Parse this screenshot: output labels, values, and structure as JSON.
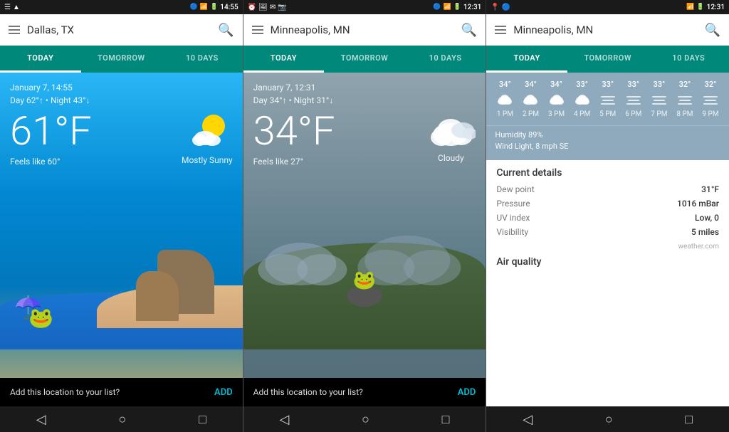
{
  "status_bars": [
    {
      "left_icons": "≡ ▲",
      "time": "14:55",
      "right_icons": "🔵 📶 🔋"
    },
    {
      "left_icons": "⏰ 🖼 ✉ 📷",
      "time": "12:31",
      "right_icons": "🔵 📶 🔋"
    },
    {
      "left_icons": "📍 🔵",
      "time": "12:31",
      "right_icons": "📶 🔋"
    }
  ],
  "panels": [
    {
      "id": "dallas",
      "search_city": "Dallas, TX",
      "tabs": [
        "TODAY",
        "TOMORROW",
        "10 DAYS"
      ],
      "active_tab": 0,
      "date": "January 7, 14:55",
      "day_night": "Day 62°↑ • Night 43°↓",
      "temp": "61°F",
      "feels_like": "Feels like 60°",
      "description": "Mostly Sunny",
      "bottom_text": "Add this location to your list?",
      "bottom_add": "ADD"
    },
    {
      "id": "minneapolis_cloudy",
      "search_city": "Minneapolis, MN",
      "tabs": [
        "TODAY",
        "TOMORROW",
        "10 DAYS"
      ],
      "active_tab": 0,
      "date": "January 7, 12:31",
      "day_night": "Day 34°↑ • Night 31°↓",
      "temp": "34°F",
      "feels_like": "Feels like 27°",
      "description": "Cloudy",
      "bottom_text": "Add this location to your list?",
      "bottom_add": "ADD"
    },
    {
      "id": "minneapolis_details",
      "search_city": "Minneapolis, MN",
      "tabs": [
        "TODAY",
        "TOMORROW",
        "10 DAYS"
      ],
      "active_tab": 0,
      "hourly": [
        {
          "time": "1 PM",
          "temp": "34°"
        },
        {
          "time": "2 PM",
          "temp": "34°"
        },
        {
          "time": "3 PM",
          "temp": "34°"
        },
        {
          "time": "4 PM",
          "temp": "33°"
        },
        {
          "time": "5 PM",
          "temp": "33°"
        },
        {
          "time": "6 PM",
          "temp": "33°"
        },
        {
          "time": "7 PM",
          "temp": "33°"
        },
        {
          "time": "8 PM",
          "temp": "32°"
        },
        {
          "time": "9 PM",
          "temp": "32°"
        }
      ],
      "humidity": "Humidity  89%",
      "wind": "Wind  Light, 8 mph SE",
      "current_details_title": "Current details",
      "details": [
        {
          "label": "Dew point",
          "value": "31°F"
        },
        {
          "label": "Pressure",
          "value": "1016 mBar"
        },
        {
          "label": "UV index",
          "value": "Low, 0"
        },
        {
          "label": "Visibility",
          "value": "5 miles"
        }
      ],
      "weather_com": "weather.com",
      "air_quality_title": "Air quality"
    }
  ],
  "nav": {
    "back": "◁",
    "home": "○",
    "recent": "□"
  }
}
